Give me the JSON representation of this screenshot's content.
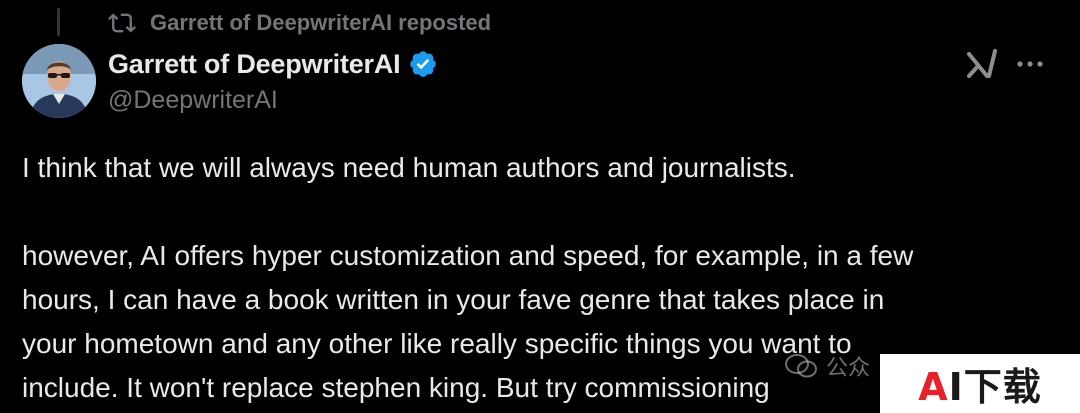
{
  "repost": {
    "text": "Garrett of DeepwriterAI reposted",
    "icon": "repost-icon"
  },
  "author": {
    "name": "Garrett of DeepwriterAI",
    "handle": "@DeepwriterAI",
    "verified": true,
    "verified_color": "#1d9bf0"
  },
  "actions": {
    "grok_icon": "grok-icon",
    "more_icon": "more-icon"
  },
  "tweet": {
    "paragraph1": "I think that we will always need human authors and journalists.",
    "lines": [
      "however, AI offers hyper customization and speed, for example, in a few",
      "hours, I can have a book written in your fave genre that takes place in",
      "your hometown and any other like really specific things you want to",
      "include. It won't replace stephen king. But try commissioning"
    ]
  },
  "watermark": {
    "faint_text": "公众",
    "badge_a": "A",
    "badge_rest": "I下载",
    "badge_a_color": "#e8202a"
  },
  "colors": {
    "background": "#000000",
    "text_primary": "#e7e9ea",
    "text_secondary": "#71767b"
  }
}
